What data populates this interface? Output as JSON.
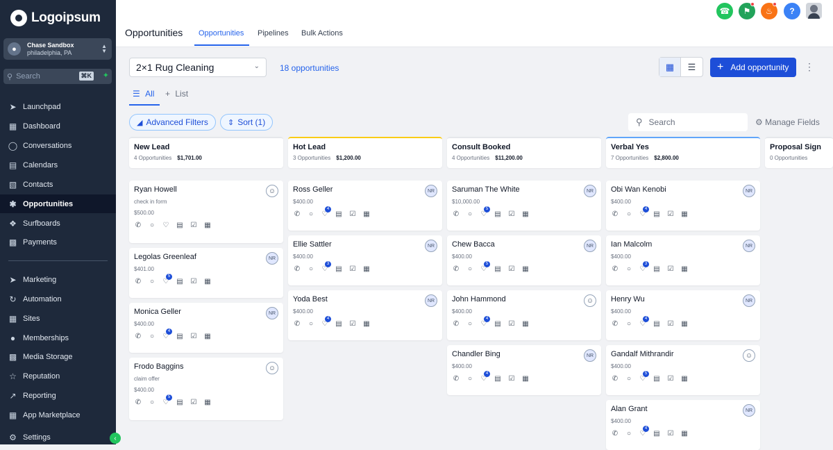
{
  "sidebar": {
    "logo": "Logoipsum",
    "account": {
      "name": "Chase Sandbox",
      "location": "philadelphia, PA"
    },
    "search": {
      "placeholder": "Search",
      "shortcut": "⌘K"
    },
    "items": [
      {
        "label": "Launchpad",
        "icon": "rocket-icon"
      },
      {
        "label": "Dashboard",
        "icon": "dashboard-icon"
      },
      {
        "label": "Conversations",
        "icon": "chat-icon"
      },
      {
        "label": "Calendars",
        "icon": "calendar-icon"
      },
      {
        "label": "Contacts",
        "icon": "contacts-icon"
      },
      {
        "label": "Opportunities",
        "icon": "opportunities-icon"
      },
      {
        "label": "Surfboards",
        "icon": "surfboard-icon"
      },
      {
        "label": "Payments",
        "icon": "payments-icon"
      },
      {
        "label": "Marketing",
        "icon": "send-icon"
      },
      {
        "label": "Automation",
        "icon": "automation-icon"
      },
      {
        "label": "Sites",
        "icon": "sites-icon"
      },
      {
        "label": "Memberships",
        "icon": "memberships-icon"
      },
      {
        "label": "Media Storage",
        "icon": "media-icon"
      },
      {
        "label": "Reputation",
        "icon": "star-icon"
      },
      {
        "label": "Reporting",
        "icon": "reporting-icon"
      },
      {
        "label": "App Marketplace",
        "icon": "marketplace-icon"
      },
      {
        "label": "Settings",
        "icon": "gear-icon"
      }
    ],
    "active": "Opportunities"
  },
  "header": {
    "title": "Opportunities",
    "tabs": [
      "Opportunities",
      "Pipelines",
      "Bulk Actions"
    ],
    "active_tab": "Opportunities"
  },
  "toolbar": {
    "pipeline": "2×1 Rug Cleaning",
    "count": "18 opportunities",
    "add_label": "Add opportunity",
    "filter_tabs": [
      "All",
      "List"
    ],
    "advanced_filters": "Advanced Filters",
    "sort": "Sort (1)",
    "search_placeholder": "Search",
    "manage_fields": "Manage Fields"
  },
  "colors": {
    "accent": "#1d4ed8",
    "hot_lead": "#facc15",
    "verbal_yes": "#60a5fa"
  },
  "columns": [
    {
      "name": "New Lead",
      "count": "4 Opportunities",
      "total": "$1,701.00",
      "cards": [
        {
          "name": "Ryan Howell",
          "sub": "check in form",
          "value": "$500.00",
          "badge": "user",
          "chat": ""
        },
        {
          "name": "Legolas Greenleaf",
          "sub": "",
          "value": "$401.00",
          "badge": "NR",
          "chat": "5"
        },
        {
          "name": "Monica Geller",
          "sub": "",
          "value": "$400.00",
          "badge": "NR",
          "chat": "4"
        },
        {
          "name": "Frodo Baggins",
          "sub": "claim offer",
          "value": "$400.00",
          "badge": "user",
          "chat": "5"
        }
      ]
    },
    {
      "name": "Hot Lead",
      "count": "3 Opportunities",
      "total": "$1,200.00",
      "cards": [
        {
          "name": "Ross Geller",
          "sub": "",
          "value": "$400.00",
          "badge": "NR",
          "chat": "4"
        },
        {
          "name": "Ellie Sattler",
          "sub": "",
          "value": "$400.00",
          "badge": "NR",
          "chat": "3"
        },
        {
          "name": "Yoda Best",
          "sub": "",
          "value": "$400.00",
          "badge": "NR",
          "chat": "4"
        }
      ]
    },
    {
      "name": "Consult Booked",
      "count": "4 Opportunities",
      "total": "$11,200.00",
      "cards": [
        {
          "name": "Saruman The White",
          "sub": "",
          "value": "$10,000.00",
          "badge": "NR",
          "chat": "5"
        },
        {
          "name": "Chew Bacca",
          "sub": "",
          "value": "$400.00",
          "badge": "NR",
          "chat": "5"
        },
        {
          "name": "John Hammond",
          "sub": "",
          "value": "$400.00",
          "badge": "user",
          "chat": "4"
        },
        {
          "name": "Chandler Bing",
          "sub": "",
          "value": "$400.00",
          "badge": "NR",
          "chat": "4"
        }
      ]
    },
    {
      "name": "Verbal Yes",
      "count": "7 Opportunities",
      "total": "$2,800.00",
      "cards": [
        {
          "name": "Obi Wan Kenobi",
          "sub": "",
          "value": "$400.00",
          "badge": "NR",
          "chat": "4"
        },
        {
          "name": "Ian Malcolm",
          "sub": "",
          "value": "$400.00",
          "badge": "NR",
          "chat": "3"
        },
        {
          "name": "Henry Wu",
          "sub": "",
          "value": "$400.00",
          "badge": "NR",
          "chat": "4"
        },
        {
          "name": "Gandalf Mithrandir",
          "sub": "",
          "value": "$400.00",
          "badge": "user",
          "chat": "5"
        },
        {
          "name": "Alan Grant",
          "sub": "",
          "value": "$400.00",
          "badge": "NR",
          "chat": "4"
        }
      ]
    },
    {
      "name": "Proposal Sign",
      "count": "0 Opportunities",
      "total": "",
      "cards": []
    }
  ]
}
